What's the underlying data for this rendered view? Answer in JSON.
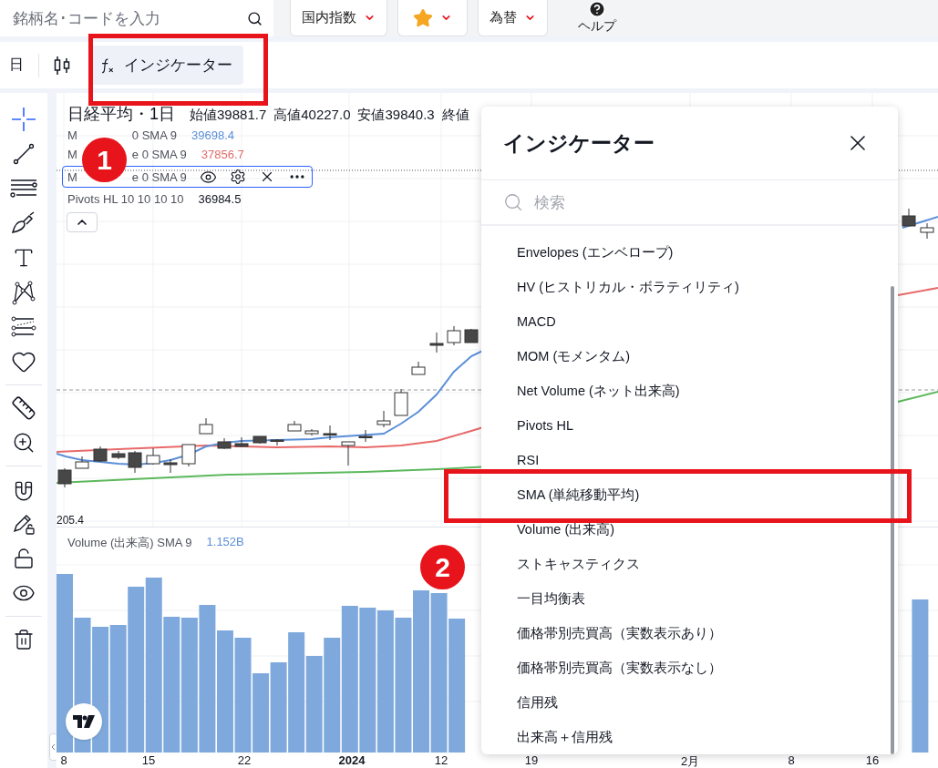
{
  "top_bar": {
    "search": {
      "placeholder": "銘柄名･コードを入力"
    },
    "menus": [
      {
        "kind": "text",
        "label": "国内指数"
      },
      {
        "kind": "star"
      },
      {
        "kind": "text",
        "label": "為替"
      }
    ],
    "help": {
      "label": "ヘルプ"
    }
  },
  "toolbar": {
    "interval": "日",
    "indicator_button": {
      "label": "インジケーター"
    }
  },
  "legend": {
    "title": "日経平均・1日",
    "ohlc": [
      "始値39881.7",
      "高値40227.0",
      "安値39840.3",
      "終値"
    ],
    "rows": [
      {
        "prefix": "M",
        "suffix": "0 SMA 9",
        "value": "39698.4",
        "color": "#5b8fd8",
        "selected": false
      },
      {
        "prefix": "M",
        "suffix": "e 0 SMA 9",
        "value": "37856.7",
        "color": "#e46b6b",
        "selected": false
      },
      {
        "prefix": "M",
        "suffix": "e 0 SMA 9",
        "selected": true
      },
      {
        "prefix": "Pivots HL 10 10 10 10",
        "value": "36984.5",
        "color": "#131722",
        "selected": false
      }
    ]
  },
  "price_label": "205.4",
  "volume_legend": {
    "label": "Volume (出来高) SMA 9",
    "value": "1.152B"
  },
  "time_axis": [
    {
      "label": "8",
      "bold": false
    },
    {
      "label": "15",
      "bold": false
    },
    {
      "label": "22",
      "bold": false
    },
    {
      "label": "2024",
      "bold": true
    },
    {
      "label": "12",
      "bold": false
    },
    {
      "label": "19",
      "bold": false
    },
    {
      "label": "2月",
      "bold": false
    },
    {
      "label": "8",
      "bold": false
    },
    {
      "label": "16",
      "bold": false
    }
  ],
  "callouts": [
    "1",
    "2"
  ],
  "indicator_panel": {
    "title": "インジケーター",
    "search": {
      "placeholder": "検索"
    },
    "items": [
      "Envelopes (エンベロープ)",
      "HV (ヒストリカル・ボラティリティ)",
      "MACD",
      "MOM (モメンタム)",
      "Net Volume (ネット出来高)",
      "Pivots HL",
      "RSI",
      "SMA (単純移動平均)",
      "Volume (出来高)",
      "ストキャスティクス",
      "一目均衡表",
      "価格帯別売買高（実数表示あり）",
      "価格帯別売買高（実数表示なし）",
      "信用残",
      "出来高＋信用残"
    ]
  }
}
